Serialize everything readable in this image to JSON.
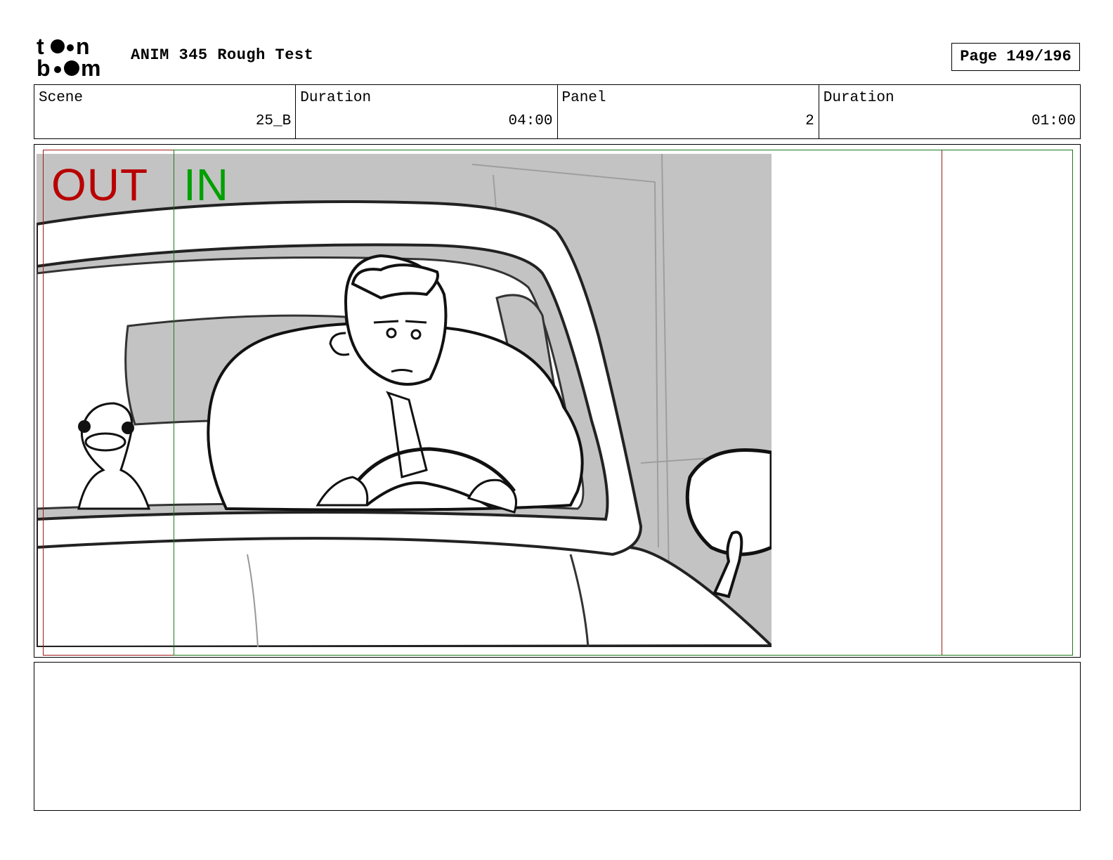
{
  "header": {
    "logo_text": "toon boom",
    "title": "ANIM 345 Rough Test",
    "page_label": "Page 149/196"
  },
  "info": {
    "scene_label": "Scene",
    "scene_value": "25_B",
    "scene_duration_label": "Duration",
    "scene_duration_value": "04:00",
    "panel_label": "Panel",
    "panel_value": "2",
    "panel_duration_label": "Duration",
    "panel_duration_value": "01:00"
  },
  "panel": {
    "out_label": "OUT",
    "in_label": "IN",
    "out_color": "#b80000",
    "in_color": "#00a000"
  },
  "notes": {
    "text": ""
  }
}
